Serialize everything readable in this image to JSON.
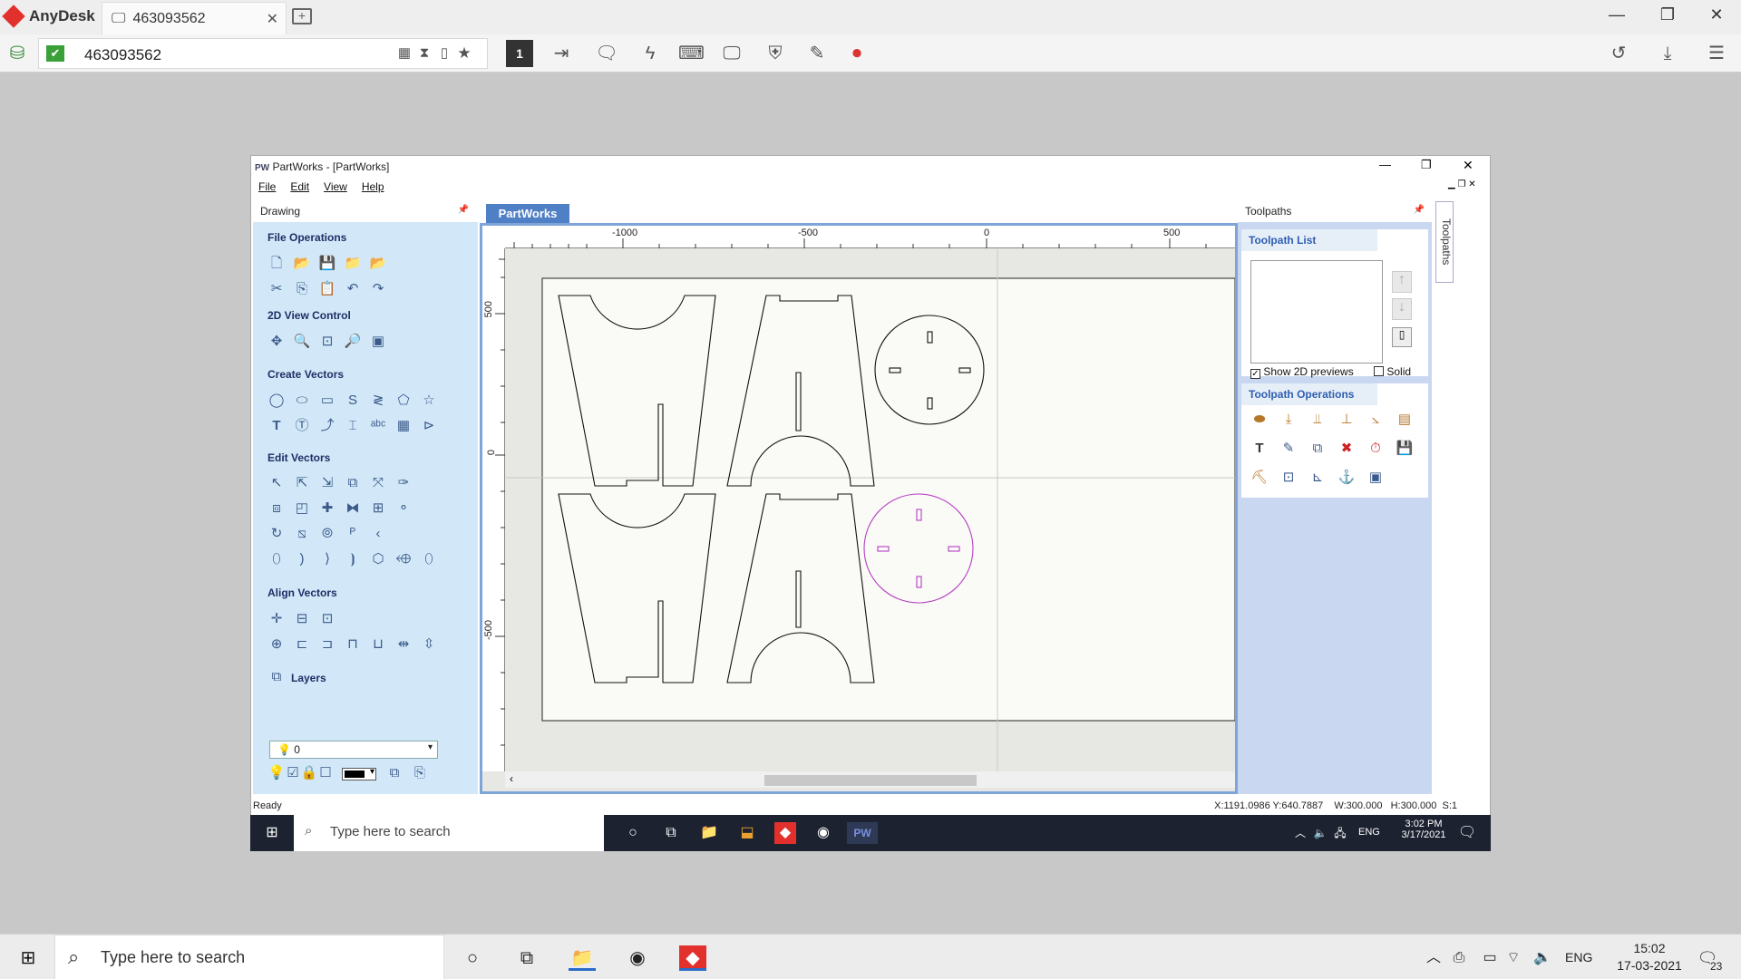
{
  "anydesk": {
    "app_name": "AnyDesk",
    "tab_label": "463093562",
    "address_value": "463093562",
    "monitor_number": "1"
  },
  "partworks": {
    "title": "PartWorks - [PartWorks]",
    "menu": [
      "File",
      "Edit",
      "View",
      "Help"
    ],
    "left_panel_title": "Drawing",
    "sections": {
      "file_ops": "File Operations",
      "view_control": "2D View Control",
      "create_vectors": "Create Vectors",
      "edit_vectors": "Edit Vectors",
      "align_vectors": "Align Vectors",
      "layers": "Layers"
    },
    "layer_value": "0",
    "doc_tab": "PartWorks",
    "ruler_top": [
      "-1000",
      "-500",
      "0",
      "500"
    ],
    "ruler_left": [
      "500",
      "0",
      "-500"
    ],
    "right_panel_title": "Toolpaths",
    "toolpath_list_title": "Toolpath List",
    "show_previews_label": "Show 2D previews",
    "solid_label": "Solid",
    "toolpath_ops_title": "Toolpath Operations",
    "vertical_tab": "Toolpaths",
    "status_left": "Ready",
    "status_right": "X:1191.0986 Y:640.7887    W:300.000   H:300.000  S:1"
  },
  "inner_taskbar": {
    "search_placeholder": "Type here to search",
    "lang": "ENG",
    "time": "3:02 PM",
    "date": "3/17/2021"
  },
  "taskbar": {
    "search_placeholder": "Type here to search",
    "lang": "ENG",
    "time": "15:02",
    "date": "17-03-2021",
    "notif_count": "23"
  },
  "colors": {
    "anydesk_red": "#e2312d",
    "panel_blue": "#d2e8f8",
    "selected_vector": "#b53fc3"
  }
}
